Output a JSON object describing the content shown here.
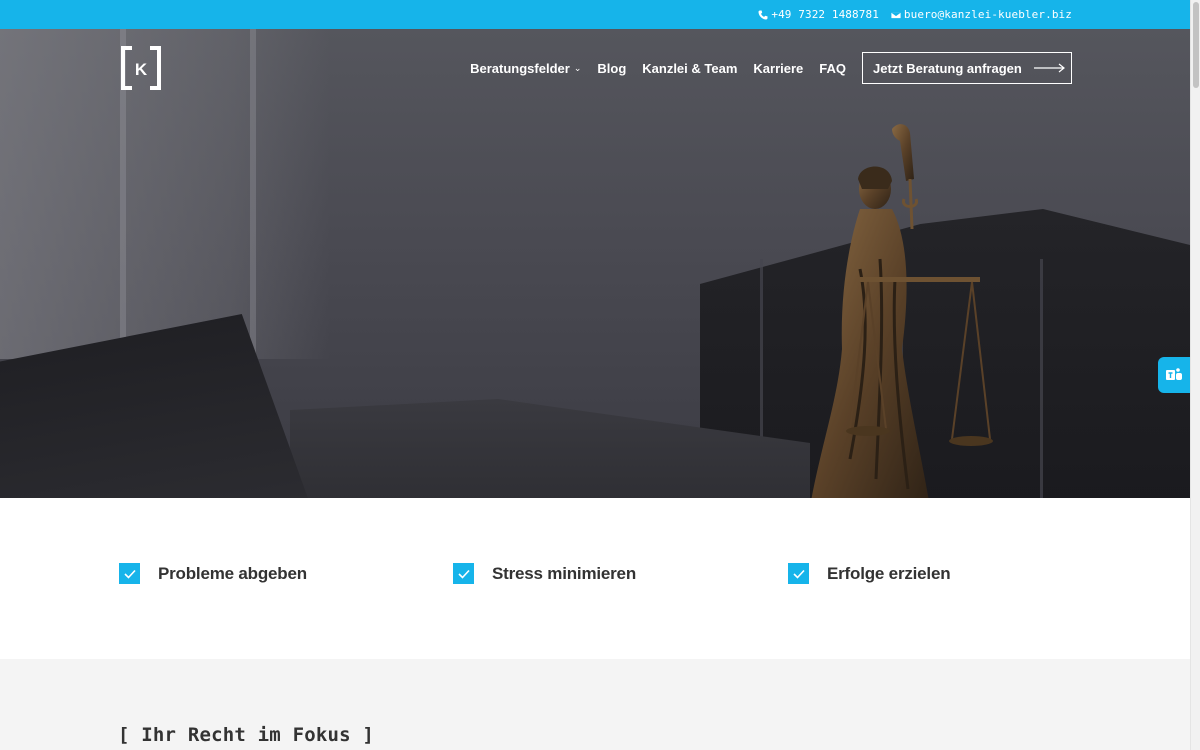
{
  "topbar": {
    "phone": "+49 7322 1488781",
    "email": "buero@kanzlei-kuebler.biz"
  },
  "header": {
    "logo_letter": "K",
    "nav": [
      {
        "label": "Beratungsfelder",
        "has_dropdown": true
      },
      {
        "label": "Blog"
      },
      {
        "label": "Kanzlei & Team"
      },
      {
        "label": "Karriere"
      },
      {
        "label": "FAQ"
      }
    ],
    "cta_label": "Jetzt Beratung anfragen"
  },
  "features": [
    {
      "label": "Probleme abgeben"
    },
    {
      "label": "Stress minimieren"
    },
    {
      "label": "Erfolge erzielen"
    }
  ],
  "focus": {
    "heading": "[ Ihr Recht im Fokus ]"
  },
  "side_button": {
    "icon": "teams-icon"
  },
  "colors": {
    "accent": "#16b4ea",
    "text": "#333333",
    "white": "#ffffff"
  }
}
